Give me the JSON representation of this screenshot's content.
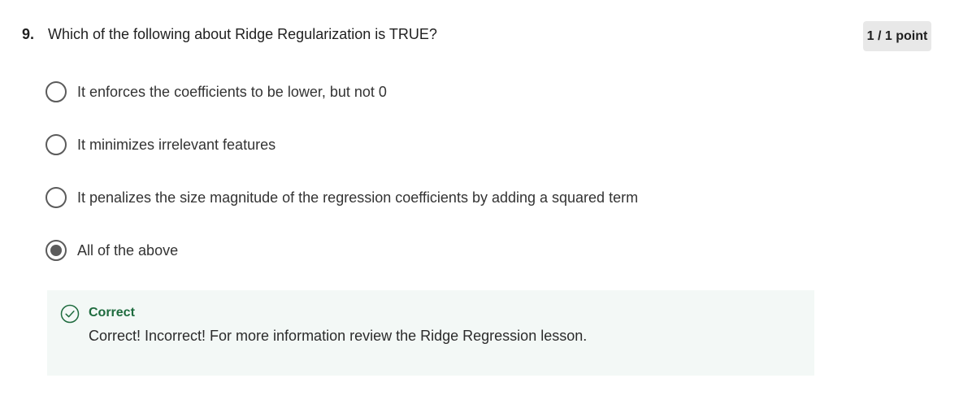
{
  "question": {
    "number": "9.",
    "text": "Which of the following about Ridge Regularization is TRUE?",
    "score": "1 / 1 point",
    "options": [
      {
        "label": "It enforces the coefficients to be lower, but not 0",
        "selected": false
      },
      {
        "label": "It minimizes irrelevant features",
        "selected": false
      },
      {
        "label": "It penalizes the size  magnitude of the regression coefficients by adding a squared term",
        "selected": false
      },
      {
        "label": "All of the above",
        "selected": true
      }
    ]
  },
  "feedback": {
    "status": "Correct",
    "message": "Correct! Incorrect! For more information review the Ridge Regression lesson.",
    "icon": "check-circle-icon",
    "accent_color": "#1e6b3e",
    "background_color": "#f3f8f6"
  }
}
